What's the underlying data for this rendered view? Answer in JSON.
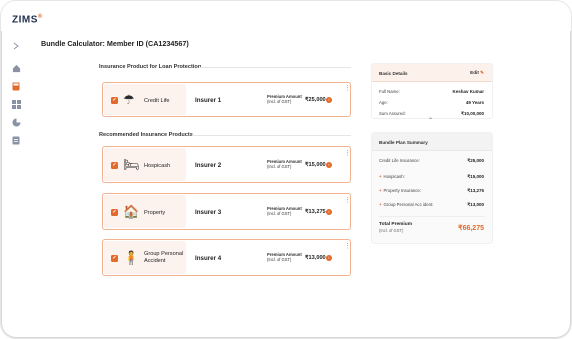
{
  "app": {
    "logo": "ZIMS",
    "logo_mark": "®"
  },
  "page": {
    "title": "Bundle Calculator: Member ID (CA1234567)"
  },
  "sections": {
    "loan": "Insurance Product for Loan Protection",
    "recommended": "Recommended Insurance Products"
  },
  "products": [
    {
      "name": "Credit Life",
      "insurer": "Insurer 1",
      "premium_label": "Premium Amount",
      "premium_note": "(Incl. of GST)",
      "amount": "₹25,000",
      "icon": "umbrella-family-icon"
    },
    {
      "name": "Hospicash",
      "insurer": "Insurer 2",
      "premium_label": "Premium Amount",
      "premium_note": "(Incl. of GST)",
      "amount": "₹15,000",
      "icon": "hospital-bed-icon"
    },
    {
      "name": "Property",
      "insurer": "Insurer 3",
      "premium_label": "Premium Amount",
      "premium_note": "(Incl. of GST)",
      "amount": "₹13,275",
      "icon": "house-shield-icon"
    },
    {
      "name": "Group Personal Accident",
      "name_l1": "Group Personal",
      "name_l2": "Accident",
      "insurer": "Insurer 4",
      "premium_label": "Premium Amount",
      "premium_note": "(Incl. of GST)",
      "amount": "₹13,000",
      "icon": "crutches-person-icon"
    }
  ],
  "basic_details": {
    "title": "Basic Details",
    "edit_label": "Edit",
    "full_name_label": "Full Name:",
    "full_name": "Keshav Kumar",
    "age_label": "Age:",
    "age": "49 Years",
    "sum_label": "Sum Assured:",
    "sum": "₹10,00,000"
  },
  "summary": {
    "title": "Bundle Plan Summary",
    "rows": [
      {
        "label": "Credit Life Insurance:",
        "value": "₹25,000",
        "plus": ""
      },
      {
        "label": "Hospicash:",
        "value": "₹15,000",
        "plus": "+"
      },
      {
        "label": "Property Insurance:",
        "value": "₹13,275",
        "plus": "+"
      },
      {
        "label": "Group Personal Acc ident:",
        "value": "₹13,000",
        "plus": "+"
      }
    ],
    "total_label": "Total Premium",
    "total_note": "(Incl. of GST)",
    "total_value": "₹66,275"
  },
  "colors": {
    "accent": "#e26a2c",
    "card_border": "#f3b393",
    "card_fill": "#fdf3ee"
  }
}
